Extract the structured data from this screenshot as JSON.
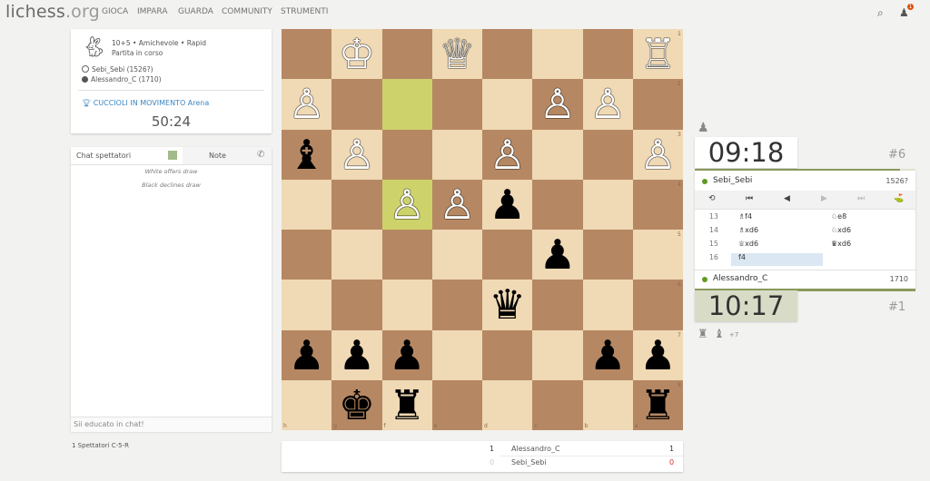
{
  "header": {
    "logo_main": "lichess",
    "logo_tld": ".org",
    "nav": [
      "GIOCA",
      "IMPARA",
      "GUARDA",
      "COMMUNITY",
      "STRUMENTI"
    ],
    "notification_count": "1"
  },
  "game_info": {
    "setup": "10+5 • Amichevole • Rapid",
    "status": "Partita in corso",
    "white_player": "Sebi_Sebi (1526?)",
    "black_player": "Alessandro_C (1710)",
    "tournament": "CUCCIOLI IN MOVIMENTO Arena",
    "tournament_clock": "50:24"
  },
  "chat": {
    "tab_chat": "Chat spettatori",
    "tab_notes": "Note",
    "messages": [
      "White offers draw",
      "Black declines draw"
    ],
    "placeholder": "Sii educato in chat!"
  },
  "spectators": "1 Spettatori C-5-R",
  "board": {
    "orientation": "black",
    "rank_labels": [
      "1",
      "2",
      "3",
      "4",
      "5",
      "6",
      "7",
      "8"
    ],
    "file_labels": [
      "h",
      "g",
      "f",
      "e",
      "d",
      "c",
      "b",
      "a"
    ],
    "highlight_squares": [
      "f2",
      "f4"
    ],
    "pieces": [
      {
        "square": "g1",
        "color": "white",
        "glyph": "♔"
      },
      {
        "square": "e1",
        "color": "white",
        "glyph": "♕"
      },
      {
        "square": "a1",
        "color": "white",
        "glyph": "♖"
      },
      {
        "square": "h2",
        "color": "white",
        "glyph": "♙"
      },
      {
        "square": "c2",
        "color": "white",
        "glyph": "♙"
      },
      {
        "square": "b2",
        "color": "white",
        "glyph": "♙"
      },
      {
        "square": "h3",
        "color": "black",
        "glyph": "♝"
      },
      {
        "square": "g3",
        "color": "white",
        "glyph": "♙"
      },
      {
        "square": "d3",
        "color": "white",
        "glyph": "♙"
      },
      {
        "square": "a3",
        "color": "white",
        "glyph": "♙"
      },
      {
        "square": "f4",
        "color": "white",
        "glyph": "♙"
      },
      {
        "square": "e4",
        "color": "white",
        "glyph": "♙"
      },
      {
        "square": "d4",
        "color": "black",
        "glyph": "♟"
      },
      {
        "square": "c5",
        "color": "black",
        "glyph": "♟"
      },
      {
        "square": "d6",
        "color": "black",
        "glyph": "♛"
      },
      {
        "square": "h7",
        "color": "black",
        "glyph": "♟"
      },
      {
        "square": "g7",
        "color": "black",
        "glyph": "♟"
      },
      {
        "square": "f7",
        "color": "black",
        "glyph": "♟"
      },
      {
        "square": "b7",
        "color": "black",
        "glyph": "♟"
      },
      {
        "square": "a7",
        "color": "black",
        "glyph": "♟"
      },
      {
        "square": "g8",
        "color": "black",
        "glyph": "♚"
      },
      {
        "square": "f8",
        "color": "black",
        "glyph": "♜"
      },
      {
        "square": "a8",
        "color": "black",
        "glyph": "♜"
      }
    ]
  },
  "score": {
    "rows": [
      {
        "left": "1",
        "name": "Alessandro_C",
        "right": "1"
      },
      {
        "left": "0",
        "name": "Sebi_Sebi",
        "right": "0"
      }
    ]
  },
  "clocks": {
    "top_time": "09:18",
    "bottom_time": "10:17",
    "top_rank": "#6",
    "bottom_rank": "#1",
    "white_time_fraction": 0.93,
    "black_time_fraction": 1.0
  },
  "moves_panel": {
    "top_player": "Sebi_Sebi",
    "top_rating": "1526?",
    "bottom_player": "Alessandro_C",
    "bottom_rating": "1710",
    "controls": [
      "⟲",
      "⏮",
      "◀",
      "▶",
      "⏭",
      "⛳"
    ],
    "moves": [
      {
        "n": "13",
        "white": "♗f4",
        "black": "♘e8"
      },
      {
        "n": "14",
        "white": "♗xd6",
        "black": "♘xd6"
      },
      {
        "n": "15",
        "white": "♕xd6",
        "black": "♛xd6"
      },
      {
        "n": "16",
        "white": "f4",
        "black": ""
      }
    ],
    "active_move": "16.white"
  },
  "captured": {
    "glyphs": [
      "♜",
      "♝"
    ],
    "extra": "+7"
  },
  "colors": {
    "light_square": "#f0d9b5",
    "dark_square": "#b58863",
    "highlight": "#aaa23a",
    "accent_green": "#629924",
    "link_blue": "#3b86c4"
  }
}
